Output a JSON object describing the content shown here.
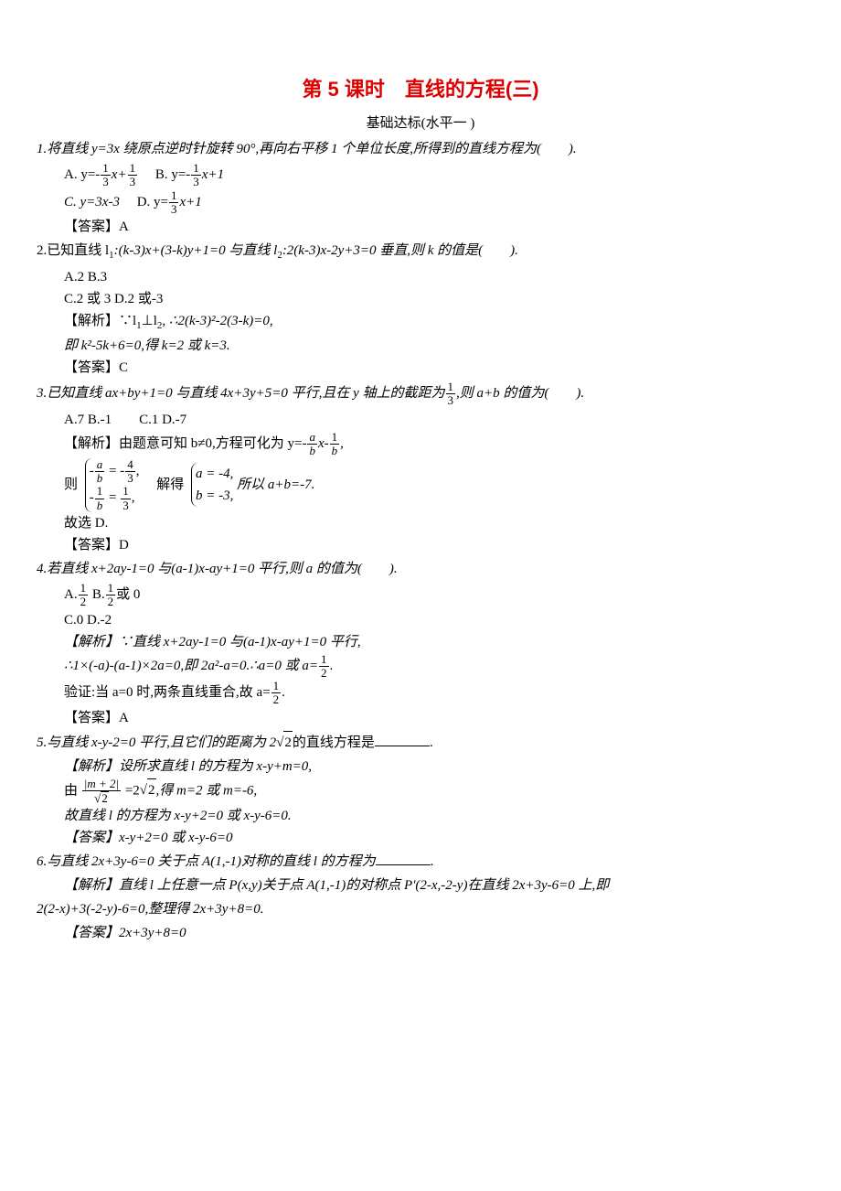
{
  "title": "第 5 课时　直线的方程(三)",
  "subtitle": "基础达标(水平一 )",
  "q1": {
    "stem": "1.将直线 y=3x 绕原点逆时针旋转 90°,再向右平移 1 个单位长度,所得到的直线方程为(　　).",
    "optA_pre": "A. y=-",
    "optA_mid": "x+",
    "optB_pre": "　B. y=-",
    "optB_mid": "x+1",
    "optC": "C. y=3x-3",
    "optD_pre": "　D. y=",
    "optD_mid": "x+1",
    "ans": "【答案】A"
  },
  "q2": {
    "stem_a": "2.已知直线 l",
    "stem_b": ":(k-3)x+(3-k)y+1=0 与直线 l",
    "stem_c": ":2(k-3)x-2y+3=0 垂直,则 k 的值是(　　).",
    "optA": "A.2 B.3",
    "optB": "C.2 或 3 D.2 或-3",
    "exp1a": "【解析】∵l",
    "exp1b": "⊥l",
    "exp1c": ", ∴2(k-3)²-2(3-k)=0,",
    "exp2": "即 k²-5k+6=0,得 k=2 或 k=3.",
    "ans": "【答案】C"
  },
  "q3": {
    "stem_a": "3.已知直线 ax+by+1=0 与直线 4x+3y+5=0 平行,且在 y 轴上的截距为",
    "stem_b": ",则 a+b 的值为(　　).",
    "opts": "A.7 B.-1　　C.1 D.-7",
    "exp1_a": "【解析】由题意可知 b≠0,方程可化为 y=-",
    "exp1_b": "x-",
    "exp1_c": ",",
    "sys_pre": "则",
    "sys_mid": "　解得",
    "sys_suf": "所以 a+b=-7.",
    "exp3": "故选 D.",
    "ans": "【答案】D"
  },
  "q4": {
    "stem": "4.若直线 x+2ay-1=0 与(a-1)x-ay+1=0 平行,则 a 的值为(　　).",
    "optA_pre": "A.",
    "optB_pre": " B.",
    "optB_suf": "或 0",
    "optC": "C.0 D.-2",
    "exp1": "【解析】∵直线 x+2ay-1=0 与(a-1)x-ay+1=0 平行,",
    "exp2_a": "∴1×(-a)-(a-1)×2a=0,即 2a²-a=0.∴a=0 或 a=",
    "exp2_b": ".",
    "exp3_a": "验证:当 a=0 时,两条直线重合,故 a=",
    "exp3_b": ".",
    "ans": "【答案】A"
  },
  "q5": {
    "stem_a": "5.与直线 x-y-2=0 平行,且它们的距离为 2",
    "stem_b": "的直线方程是",
    "stem_c": ".",
    "exp1": "【解析】设所求直线 l 的方程为 x-y+m=0,",
    "exp2_a": "由 ",
    "exp2_b": " =2",
    "exp2_c": ",得 m=2 或 m=-6,",
    "exp3": "故直线 l 的方程为 x-y+2=0 或 x-y-6=0.",
    "ans": "【答案】x-y+2=0 或 x-y-6=0"
  },
  "q6": {
    "stem_a": "6.与直线 2x+3y-6=0 关于点 A(1,-1)对称的直线 l 的方程为",
    "stem_b": ".",
    "exp1": "【解析】直线 l 上任意一点 P(x,y)关于点 A(1,-1)的对称点 P'(2-x,-2-y)在直线 2x+3y-6=0 上,即",
    "exp2": "2(2-x)+3(-2-y)-6=0,整理得 2x+3y+8=0.",
    "ans": "【答案】2x+3y+8=0"
  },
  "nums": {
    "one": "1",
    "two": "2",
    "three": "3",
    "four": "4",
    "a": "a",
    "b": "b",
    "m2": "|m + 2|",
    "sqrt2": "2"
  },
  "sys3": {
    "r1a": "-",
    "r1b": " = -",
    "r1c": ",",
    "r2a": "-",
    "r2b": " = ",
    "r2c": ",",
    "sola": "a = -4,",
    "solb": "b = -3,"
  }
}
